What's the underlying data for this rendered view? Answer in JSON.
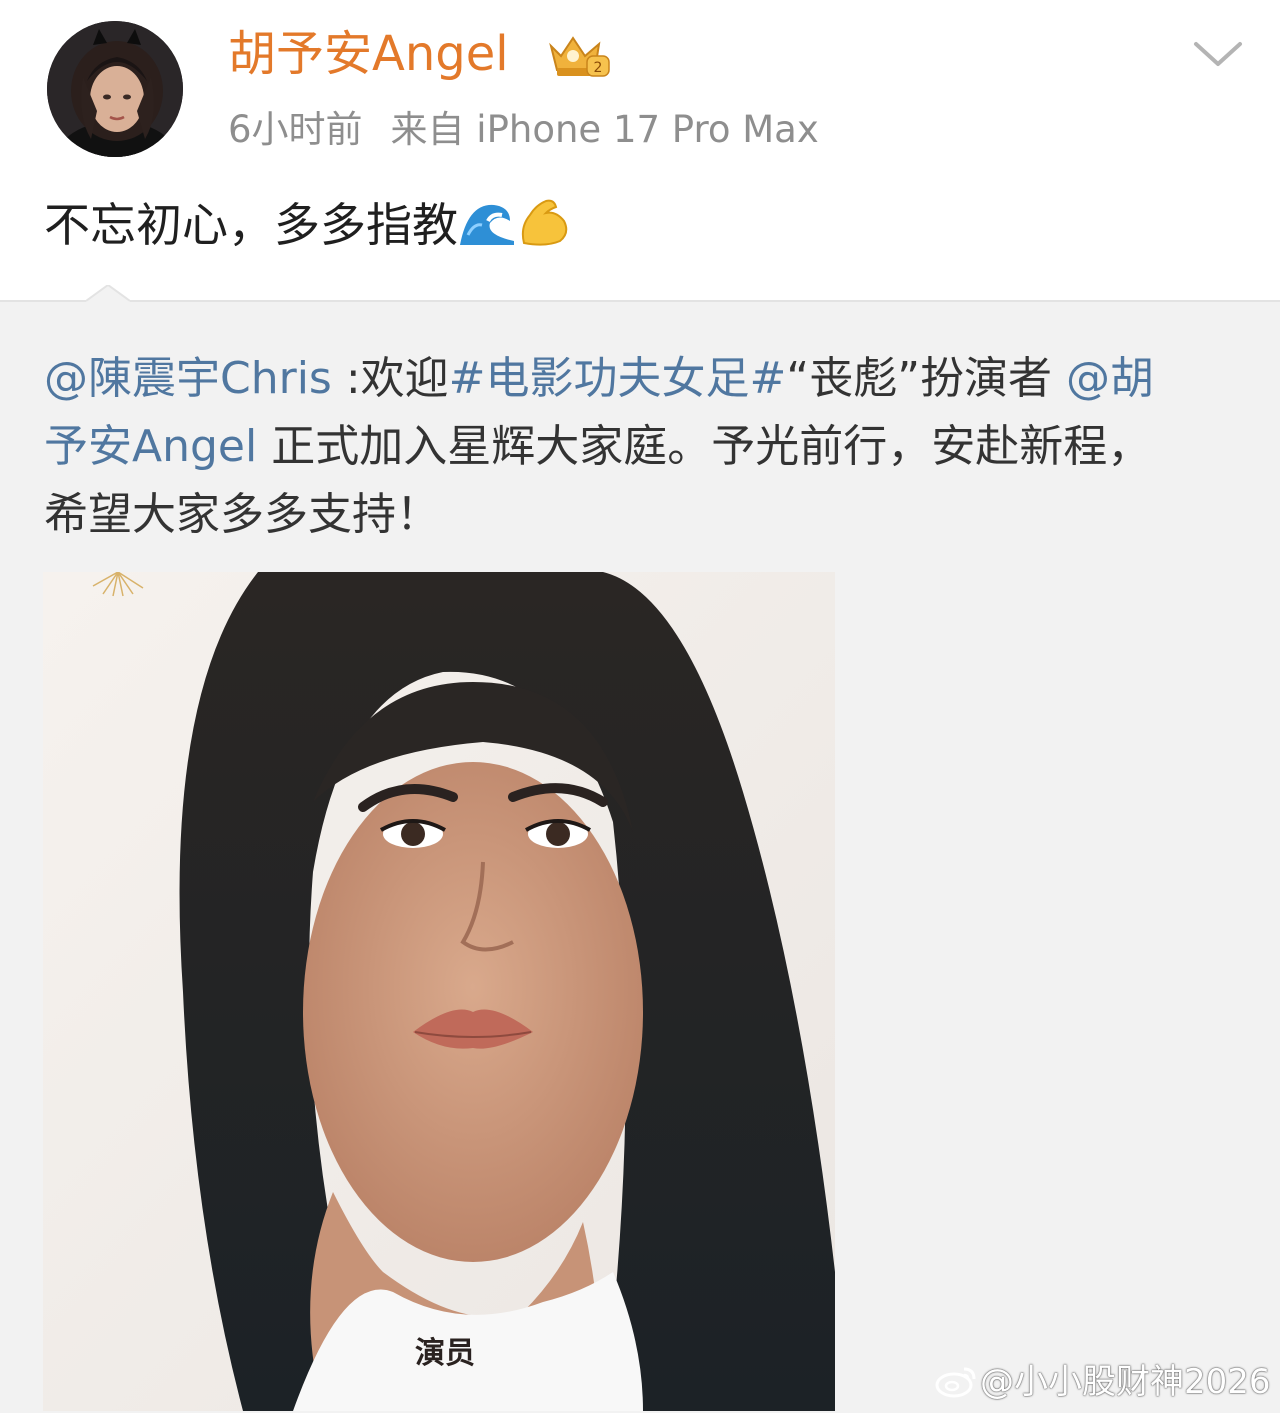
{
  "header": {
    "username": "胡予安Angel",
    "timestamp": "6小时前",
    "source": "来自 iPhone 17 Pro Max",
    "avatar_icon": "user-avatar",
    "badge_icon": "vip-crown-icon",
    "menu_icon": "chevron-down-icon"
  },
  "post": {
    "text": "不忘初心，多多指教",
    "emojis": [
      "wave-emoji",
      "flexed-biceps-emoji"
    ]
  },
  "repost": {
    "mention_author": "@陳震宇Chris",
    "colon_welcome": " :欢迎",
    "hashtag": "#电影功夫女足#",
    "role_text": "“丧彪”扮演者 ",
    "mention_angel_part1": "@胡",
    "mention_angel_part2": "予安Angel",
    "line2_rest": " 正式加入星辉大家庭。予光前行，安赴新程，",
    "line3": "希望大家多多支持！",
    "image_caption": "演员"
  },
  "watermark": {
    "text": "@小小股财神2026",
    "logo_icon": "weibo-logo-icon"
  },
  "colors": {
    "username": "#e3792a",
    "link": "#5077a0",
    "meta": "#8e8e8e",
    "repost_bg": "#f2f2f2"
  }
}
